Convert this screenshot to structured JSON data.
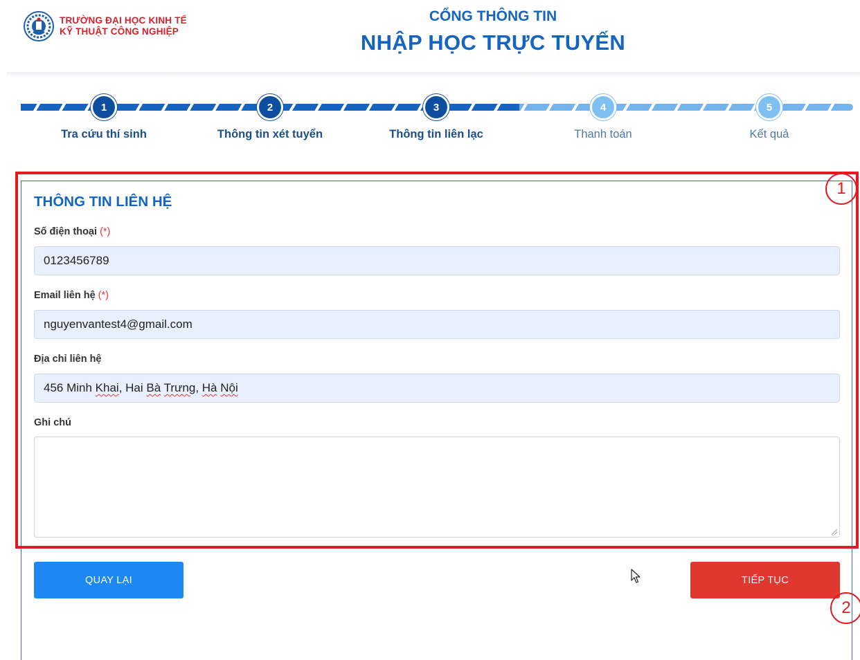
{
  "header": {
    "school_line1": "TRƯỜNG ĐẠI HỌC KINH TẾ",
    "school_line2": "KỸ THUẬT CÔNG NGHIỆP",
    "portal_subtitle": "CỔNG THÔNG TIN",
    "portal_title": "NHẬP HỌC TRỰC TUYẾN"
  },
  "steps": [
    {
      "number": "1",
      "label": "Tra cứu thí sinh",
      "state": "completed"
    },
    {
      "number": "2",
      "label": "Thông tin xét tuyển",
      "state": "completed"
    },
    {
      "number": "3",
      "label": "Thông tin liên lạc",
      "state": "current"
    },
    {
      "number": "4",
      "label": "Thanh toán",
      "state": "pending"
    },
    {
      "number": "5",
      "label": "Kết quả",
      "state": "pending"
    }
  ],
  "form": {
    "section_title": "THÔNG TIN LIÊN HỆ",
    "required_mark": "(*)",
    "phone": {
      "label": "Số điện thoại",
      "value": "0123456789"
    },
    "email": {
      "label": "Email liên hệ",
      "value": "nguyenvantest4@gmail.com"
    },
    "address": {
      "label": "Địa chỉ liên hệ",
      "value_parts": [
        "456 Minh ",
        "Khai",
        ", Hai ",
        "Bà",
        " ",
        "Trưng",
        ", ",
        "Hà",
        " ",
        "Nội"
      ]
    },
    "note": {
      "label": "Ghi chú",
      "value": ""
    }
  },
  "buttons": {
    "back": "QUAY LẠI",
    "next": "TIẾP TỤC"
  },
  "annotations": {
    "marker1": "1",
    "marker2": "2"
  },
  "colors": {
    "brand_blue": "#1565c0",
    "step_done": "#0d4f9e",
    "step_todo": "#7ec0f2",
    "back_button": "#1e88f2",
    "next_button": "#e0372f",
    "annotation_red": "#e51921",
    "school_red": "#d6212b"
  }
}
